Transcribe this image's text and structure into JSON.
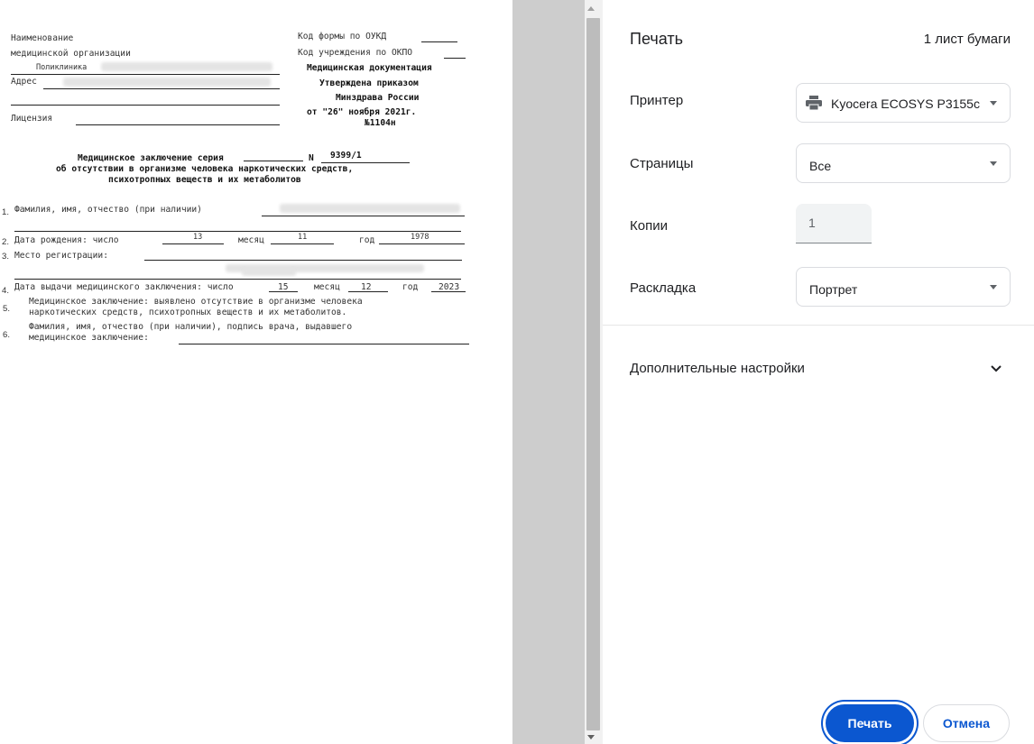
{
  "preview": {
    "left_header": {
      "line1": "Наименование",
      "line2": "медицинской организации",
      "org": "Поликлиника",
      "address": "Адрес",
      "license": "Лицензия"
    },
    "right_header": {
      "okud": "Код формы по ОУКД",
      "okpo": "Код учреждения по ОКПО",
      "med_doc": "Медицинская документация",
      "approved": "Утверждена приказом",
      "ministry": "Минздрава России",
      "date": "от \"26\" ноября 2021г.",
      "order": "№1104н"
    },
    "title": {
      "line1_prefix": "Медицинское заключение серия",
      "n_label": "N",
      "number": "9399/1",
      "line2": "об отсутствии в организме человека наркотических средств,",
      "line3": "психотропных веществ и их метаболитов"
    },
    "items": {
      "i1_num": "1.",
      "i1": "Фамилия, имя, отчество (при наличии)",
      "i2_num": "2.",
      "i2": "Дата рождения: число",
      "i2_day": "13",
      "i2_month_label": "месяц",
      "i2_month": "11",
      "i2_year_label": "год",
      "i2_year": "1978",
      "i3_num": "3.",
      "i3": "Место регистрации:",
      "i4_num": "4.",
      "i4": "Дата выдачи медицинского заключения: число",
      "i4_day": "15",
      "i4_month_label": "месяц",
      "i4_month": "12",
      "i4_year_label": "год",
      "i4_year": "2023",
      "i5_num": "5.",
      "i5_line1": "Медицинское заключение: выявлено отсутствие в организме человека",
      "i5_line2": "наркотических средств, психотропных веществ и их метаболитов.",
      "i6_num": "6.",
      "i6_line1": "Фамилия, имя, отчество (при наличии), подпись врача, выдавшего",
      "i6_line2": "медицинское заключение:"
    }
  },
  "panel": {
    "title": "Печать",
    "sheets": "1 лист бумаги",
    "printer_label": "Принтер",
    "printer_value": "Kyocera ECOSYS P3155c",
    "pages_label": "Страницы",
    "pages_value": "Все",
    "copies_label": "Копии",
    "copies_value": "1",
    "layout_label": "Раскладка",
    "layout_value": "Портрет",
    "more_settings": "Дополнительные настройки",
    "print_button": "Печать",
    "cancel_button": "Отмена"
  },
  "colors": {
    "accent": "#1a73e8",
    "print_button_bg": "#0b57d0"
  },
  "icons": {
    "printer": "printer-icon",
    "dropdown": "dropdown-caret-icon",
    "expand": "chevron-down-icon"
  }
}
